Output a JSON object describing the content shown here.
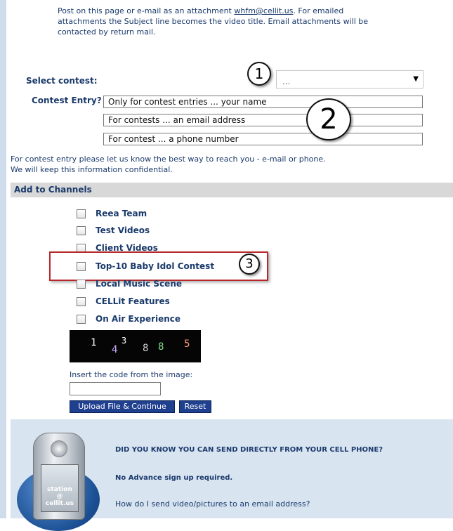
{
  "intro": {
    "text_before": "Post on this page or e-mail as an attachment ",
    "email": "whfm@cellit.us",
    "text_after": ". For emailed attachments the Subject line becomes the video title. Email attachments will be contacted by return mail."
  },
  "contest": {
    "select_label": "Select contest:",
    "select_value": "...",
    "entry_label": "Contest Entry?",
    "name_value": "Only for contest entries ... your name",
    "email_value": "For contests ... an email address",
    "phone_value": "For contest ... a phone number"
  },
  "callouts": {
    "one": "1",
    "two": "2",
    "three": "3"
  },
  "note": {
    "line1": "For contest entry please let us know the best way to reach you - e-mail or phone.",
    "line2": "We will keep this information confidential."
  },
  "channels": {
    "header": "Add to Channels",
    "items": [
      "Reea Team",
      "Test Videos",
      "Client Videos",
      "Top-10 Baby Idol Contest",
      "Local Music Scene",
      "CELLit Features",
      "On Air Experience"
    ]
  },
  "captcha": {
    "chars": [
      "1",
      "4",
      "3",
      "8",
      "8",
      "5"
    ],
    "colors": [
      "#ffffff",
      "#c8a8ff",
      "#ffffff",
      "#d0d0d0",
      "#7fe08a",
      "#ff9a7a"
    ],
    "label": "Insert the code from the image:"
  },
  "buttons": {
    "upload": "Upload File & Continue",
    "reset": "Reset"
  },
  "promo": {
    "headline": "DID YOU KNOW YOU CAN SEND DIRECTLY FROM YOUR CELL PHONE?",
    "line2": "No Advance sign up required.",
    "line3": "How do I send video/pictures to an email address?",
    "phone_brand_1": "station @",
    "phone_brand_2": "cellit.us"
  },
  "colors": {
    "text": "#1a3a6b",
    "button": "#1f3f8f",
    "highlight": "#b8282b",
    "promo_bg": "#d9e4f1"
  }
}
